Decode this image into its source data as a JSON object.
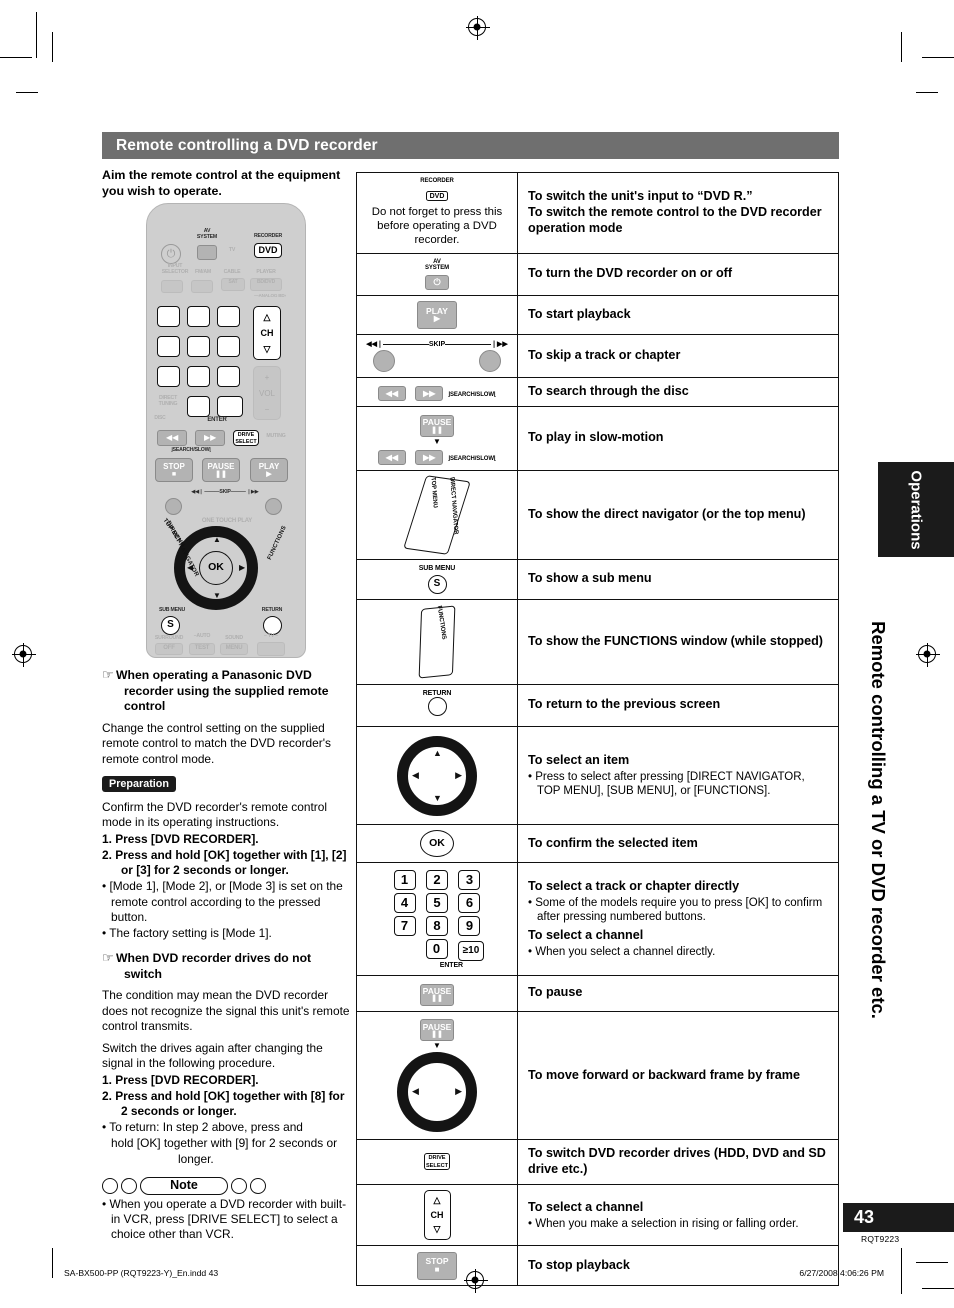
{
  "section": {
    "title": "Remote controlling a DVD recorder"
  },
  "left": {
    "lead": "Aim the remote control at the equipment you wish to operate.",
    "heading1": "When operating a Panasonic DVD recorder using the supplied remote control",
    "para1": "Change the control setting on the supplied remote control to match the DVD recorder's remote control mode.",
    "preparation_badge": "Preparation",
    "para2": "Confirm the DVD recorder's remote control mode in its operating instructions.",
    "step1": "1.  Press [DVD RECORDER].",
    "step2": "2.  Press and hold [OK] together with [1], [2] or [3] for 2 seconds or longer.",
    "bullet1": "• [Mode 1], [Mode 2], or [Mode 3] is set on the remote control according to the pressed button.",
    "bullet2": "• The factory setting is [Mode 1].",
    "heading2": "When DVD recorder drives do not switch",
    "para3": "The condition may mean the DVD recorder does not recognize the signal this unit's remote control transmits.",
    "para4": "Switch the drives again after changing the signal in the following procedure.",
    "step3": "1.  Press [DVD RECORDER].",
    "step4": "2.  Press and hold [OK] together with [8] for 2 seconds or longer.",
    "bullet3": "• To return: In step 2 above, press and",
    "bullet3b": "hold [OK] together with [9] for 2 seconds or longer.",
    "note_label": "Note",
    "note_bullet": "• When you operate a DVD recorder with built-in VCR, press [DRIVE SELECT] to select a choice other than VCR."
  },
  "remote": {
    "av_system": "AV\nSYSTEM",
    "recorder": "RECORDER",
    "dvd": "DVD",
    "tv": "TV",
    "input_selector": "INPUT\nSELECTOR",
    "fm_am": "FM/AM",
    "cable": "CABLE",
    "sat": "SAT",
    "player": "PLAYER",
    "bd_dvd": "BD/DVD",
    "analog_bd": "ANALOG BD",
    "ch": "CH",
    "vol": "VOL",
    "keys": [
      "1",
      "2",
      "3",
      "4",
      "5",
      "6",
      "7",
      "8",
      "9",
      "0"
    ],
    "gte10": "≥10",
    "enter": "ENTER",
    "direct_tuning": "DIRECT\nTUNING",
    "disc": "DISC",
    "search_slow": "SEARCH/SLOW",
    "drive_select": "DRIVE\nSELECT",
    "muting": "MUTING",
    "stop": "STOP",
    "pause": "PAUSE",
    "play": "PLAY",
    "skip": "SKIP",
    "one_touch_play": "ONE TOUCH PLAY",
    "top_menu": "TOP MENU",
    "direct_navigator": "DIRECT NAVIGATOR",
    "functions": "FUNCTIONS",
    "sub_menu": "SUB MENU",
    "return": "RETURN",
    "ok": "OK",
    "s": "S",
    "surround": "SURROUND",
    "off": "OFF",
    "auto": "AUTO",
    "test": "TEST",
    "sound": "SOUND",
    "menu": "MENU",
    "tv_bottom": "TV"
  },
  "table": {
    "rows": [
      {
        "icon": "dvd-recorder-button",
        "icon_label_top": "RECORDER",
        "icon_label_box": "DVD",
        "icon_caption": "Do not forget to press this before operating a DVD recorder.",
        "desc_lines": [
          "To switch the unit's input to “DVD R.”",
          "To switch the remote control to the DVD recorder operation mode"
        ]
      },
      {
        "icon": "av-system-power-button",
        "icon_label_top": "AV\nSYSTEM",
        "desc_lines": [
          "To turn the DVD recorder on or off"
        ]
      },
      {
        "icon": "play-button",
        "icon_label_box": "PLAY",
        "desc_lines": [
          "To start playback"
        ]
      },
      {
        "icon": "skip-buttons",
        "icon_label_top": "SKIP",
        "desc_lines": [
          "To skip a track or chapter"
        ]
      },
      {
        "icon": "search-slow-buttons",
        "icon_label_bottom": "SEARCH/SLOW",
        "desc_lines": [
          "To search through the disc"
        ]
      },
      {
        "icon": "pause-then-search-slow",
        "icon_label_box": "PAUSE",
        "icon_label_bottom": "SEARCH/SLOW",
        "desc_lines": [
          "To play in slow-motion"
        ]
      },
      {
        "icon": "top-menu-direct-navigator-button",
        "icon_label_top": "TOP MENU",
        "icon_label_bottom": "DIRECT NAVIGATOR",
        "desc_lines": [
          "To show the direct navigator (or the top menu)"
        ]
      },
      {
        "icon": "sub-menu-button",
        "icon_label_top": "SUB MENU",
        "icon_label_box": "S",
        "desc_lines": [
          "To show a sub menu"
        ]
      },
      {
        "icon": "functions-button",
        "icon_label_top": "FUNCTIONS",
        "desc_lines": [
          "To show the FUNCTIONS window (while stopped)"
        ]
      },
      {
        "icon": "return-button",
        "icon_label_top": "RETURN",
        "desc_lines": [
          "To return to the previous screen"
        ]
      },
      {
        "icon": "direction-pad",
        "desc_lines": [
          "To select an item"
        ],
        "desc_bullets": [
          "• Press to select after pressing [DIRECT NAVIGATOR, TOP MENU], [SUB MENU], or [FUNCTIONS]."
        ]
      },
      {
        "icon": "ok-button",
        "icon_label_box": "OK",
        "desc_lines": [
          "To confirm the selected item"
        ]
      },
      {
        "icon": "numeric-keypad",
        "icon_label_bottom": "ENTER",
        "desc_lines": [
          "To select a track or chapter directly"
        ],
        "desc_bullets": [
          "• Some of the models require you to press [OK] to confirm after pressing numbered buttons."
        ],
        "desc_lines2": [
          "To select a channel"
        ],
        "desc_bullets2": [
          "• When you select a channel directly."
        ]
      },
      {
        "icon": "pause-button",
        "icon_label_box": "PAUSE",
        "desc_lines": [
          "To pause"
        ]
      },
      {
        "icon": "pause-then-direction-pad",
        "icon_label_box": "PAUSE",
        "desc_lines": [
          "To move forward or backward frame by frame"
        ]
      },
      {
        "icon": "drive-select-button",
        "icon_label_box": "DRIVE\nSELECT",
        "desc_lines": [
          "To switch DVD recorder drives (HDD, DVD and SD drive etc.)"
        ]
      },
      {
        "icon": "channel-up-down-button",
        "icon_label_box": "CH",
        "desc_lines": [
          "To select a channel"
        ],
        "desc_bullets": [
          "• When you make a selection in rising or falling order."
        ]
      },
      {
        "icon": "stop-button",
        "icon_label_box": "STOP",
        "desc_lines": [
          "To stop playback"
        ]
      }
    ]
  },
  "sidebar": {
    "tab_label": "Operations",
    "side_title": "Remote controlling a TV or DVD recorder etc.",
    "page_number": "43",
    "doc_code": "RQT9223"
  },
  "footer": {
    "left": "SA-BX500-PP (RQT9223-Y)_En.indd   43",
    "right": "6/27/2008   4:06:26 PM"
  }
}
